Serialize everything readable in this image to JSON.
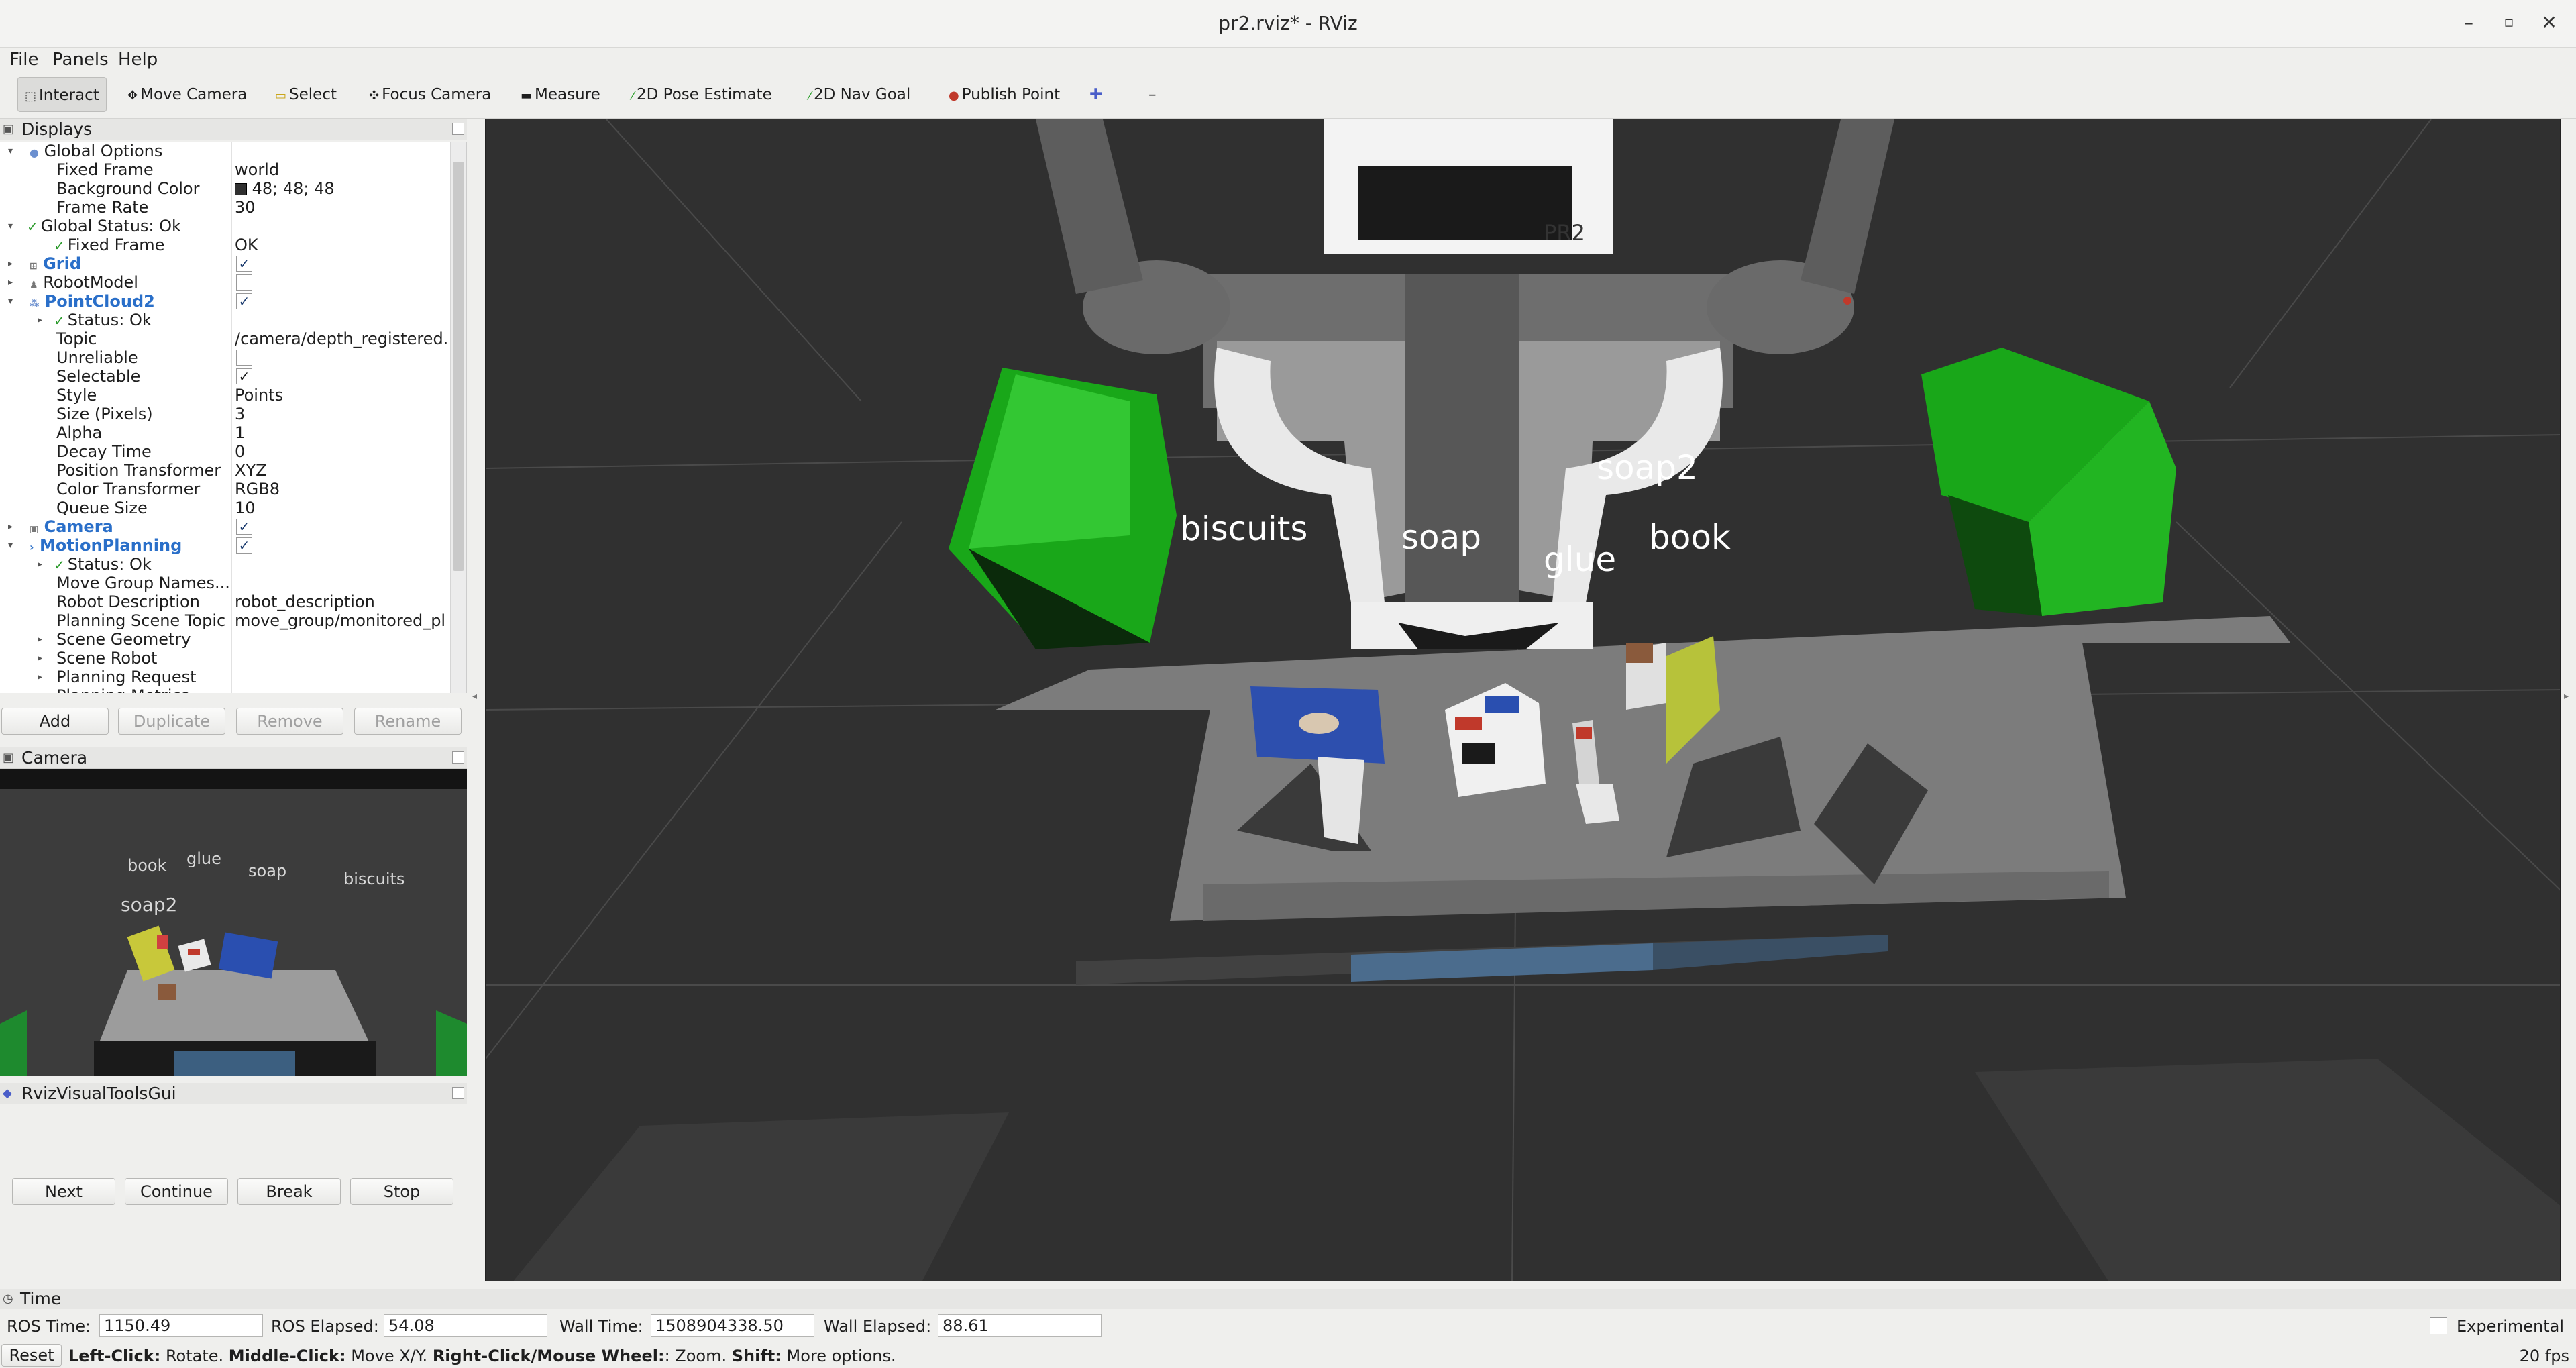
{
  "window": {
    "title": "pr2.rviz* - RViz"
  },
  "menu": [
    "File",
    "Panels",
    "Help"
  ],
  "toolbar": {
    "tools": [
      "Interact",
      "Move Camera",
      "Select",
      "Focus Camera",
      "Measure",
      "2D Pose Estimate",
      "2D Nav Goal",
      "Publish Point"
    ]
  },
  "displays": {
    "title": "Displays",
    "rows": [
      {
        "name": "Global Options",
        "value": ""
      },
      {
        "name": "Fixed Frame",
        "value": "world"
      },
      {
        "name": "Background Color",
        "value": "48; 48; 48"
      },
      {
        "name": "Frame Rate",
        "value": "30"
      },
      {
        "name": "Global Status: Ok",
        "value": ""
      },
      {
        "name": "Fixed Frame",
        "value": "OK"
      },
      {
        "name": "Grid",
        "value": ""
      },
      {
        "name": "RobotModel",
        "value": ""
      },
      {
        "name": "PointCloud2",
        "value": ""
      },
      {
        "name": "Status: Ok",
        "value": ""
      },
      {
        "name": "Topic",
        "value": "/camera/depth_registered."
      },
      {
        "name": "Unreliable",
        "value": ""
      },
      {
        "name": "Selectable",
        "value": ""
      },
      {
        "name": "Style",
        "value": "Points"
      },
      {
        "name": "Size (Pixels)",
        "value": "3"
      },
      {
        "name": "Alpha",
        "value": "1"
      },
      {
        "name": "Decay Time",
        "value": "0"
      },
      {
        "name": "Position Transformer",
        "value": "XYZ"
      },
      {
        "name": "Color Transformer",
        "value": "RGB8"
      },
      {
        "name": "Queue Size",
        "value": "10"
      },
      {
        "name": "Camera",
        "value": ""
      },
      {
        "name": "MotionPlanning",
        "value": ""
      },
      {
        "name": "Status: Ok",
        "value": ""
      },
      {
        "name": "Move Group Names...",
        "value": ""
      },
      {
        "name": "Robot Description",
        "value": "robot_description"
      },
      {
        "name": "Planning Scene Topic",
        "value": "move_group/monitored_pl"
      },
      {
        "name": "Scene Geometry",
        "value": ""
      },
      {
        "name": "Scene Robot",
        "value": ""
      },
      {
        "name": "Planning Request",
        "value": ""
      },
      {
        "name": "Planning Metrics",
        "value": ""
      }
    ],
    "buttons": [
      "Add",
      "Duplicate",
      "Remove",
      "Rename"
    ]
  },
  "camera_panel": {
    "title": "Camera",
    "labels": [
      "book",
      "glue",
      "soap",
      "biscuits",
      "soap2"
    ]
  },
  "rviz_tools": {
    "title": "RvizVisualToolsGui",
    "buttons": [
      "Next",
      "Continue",
      "Break",
      "Stop"
    ]
  },
  "scene_labels": {
    "biscuits": "biscuits",
    "soap": "soap",
    "glue": "glue",
    "book": "book",
    "soap2": "soap2",
    "robot_badge": "PR2"
  },
  "time": {
    "title": "Time",
    "ros_time_label": "ROS Time:",
    "ros_time": "1150.49",
    "ros_elapsed_label": "ROS Elapsed:",
    "ros_elapsed": "54.08",
    "wall_time_label": "Wall Time:",
    "wall_time": "1508904338.50",
    "wall_elapsed_label": "Wall Elapsed:",
    "wall_elapsed": "88.61",
    "experimental": "Experimental"
  },
  "status": {
    "reset": "Reset",
    "left_click_key": "Left-Click:",
    "left_click_text": "Rotate.",
    "middle_click_key": "Middle-Click:",
    "middle_click_text": "Move X/Y.",
    "right_click_key": "Right-Click/Mouse Wheel:",
    "right_click_text": ": Zoom.",
    "shift_key": "Shift:",
    "shift_text": "More options.",
    "fps": "20 fps"
  },
  "colors": {
    "background": "#303030",
    "bin_green": "#22b522",
    "accent_blue": "#2a6fc9"
  }
}
